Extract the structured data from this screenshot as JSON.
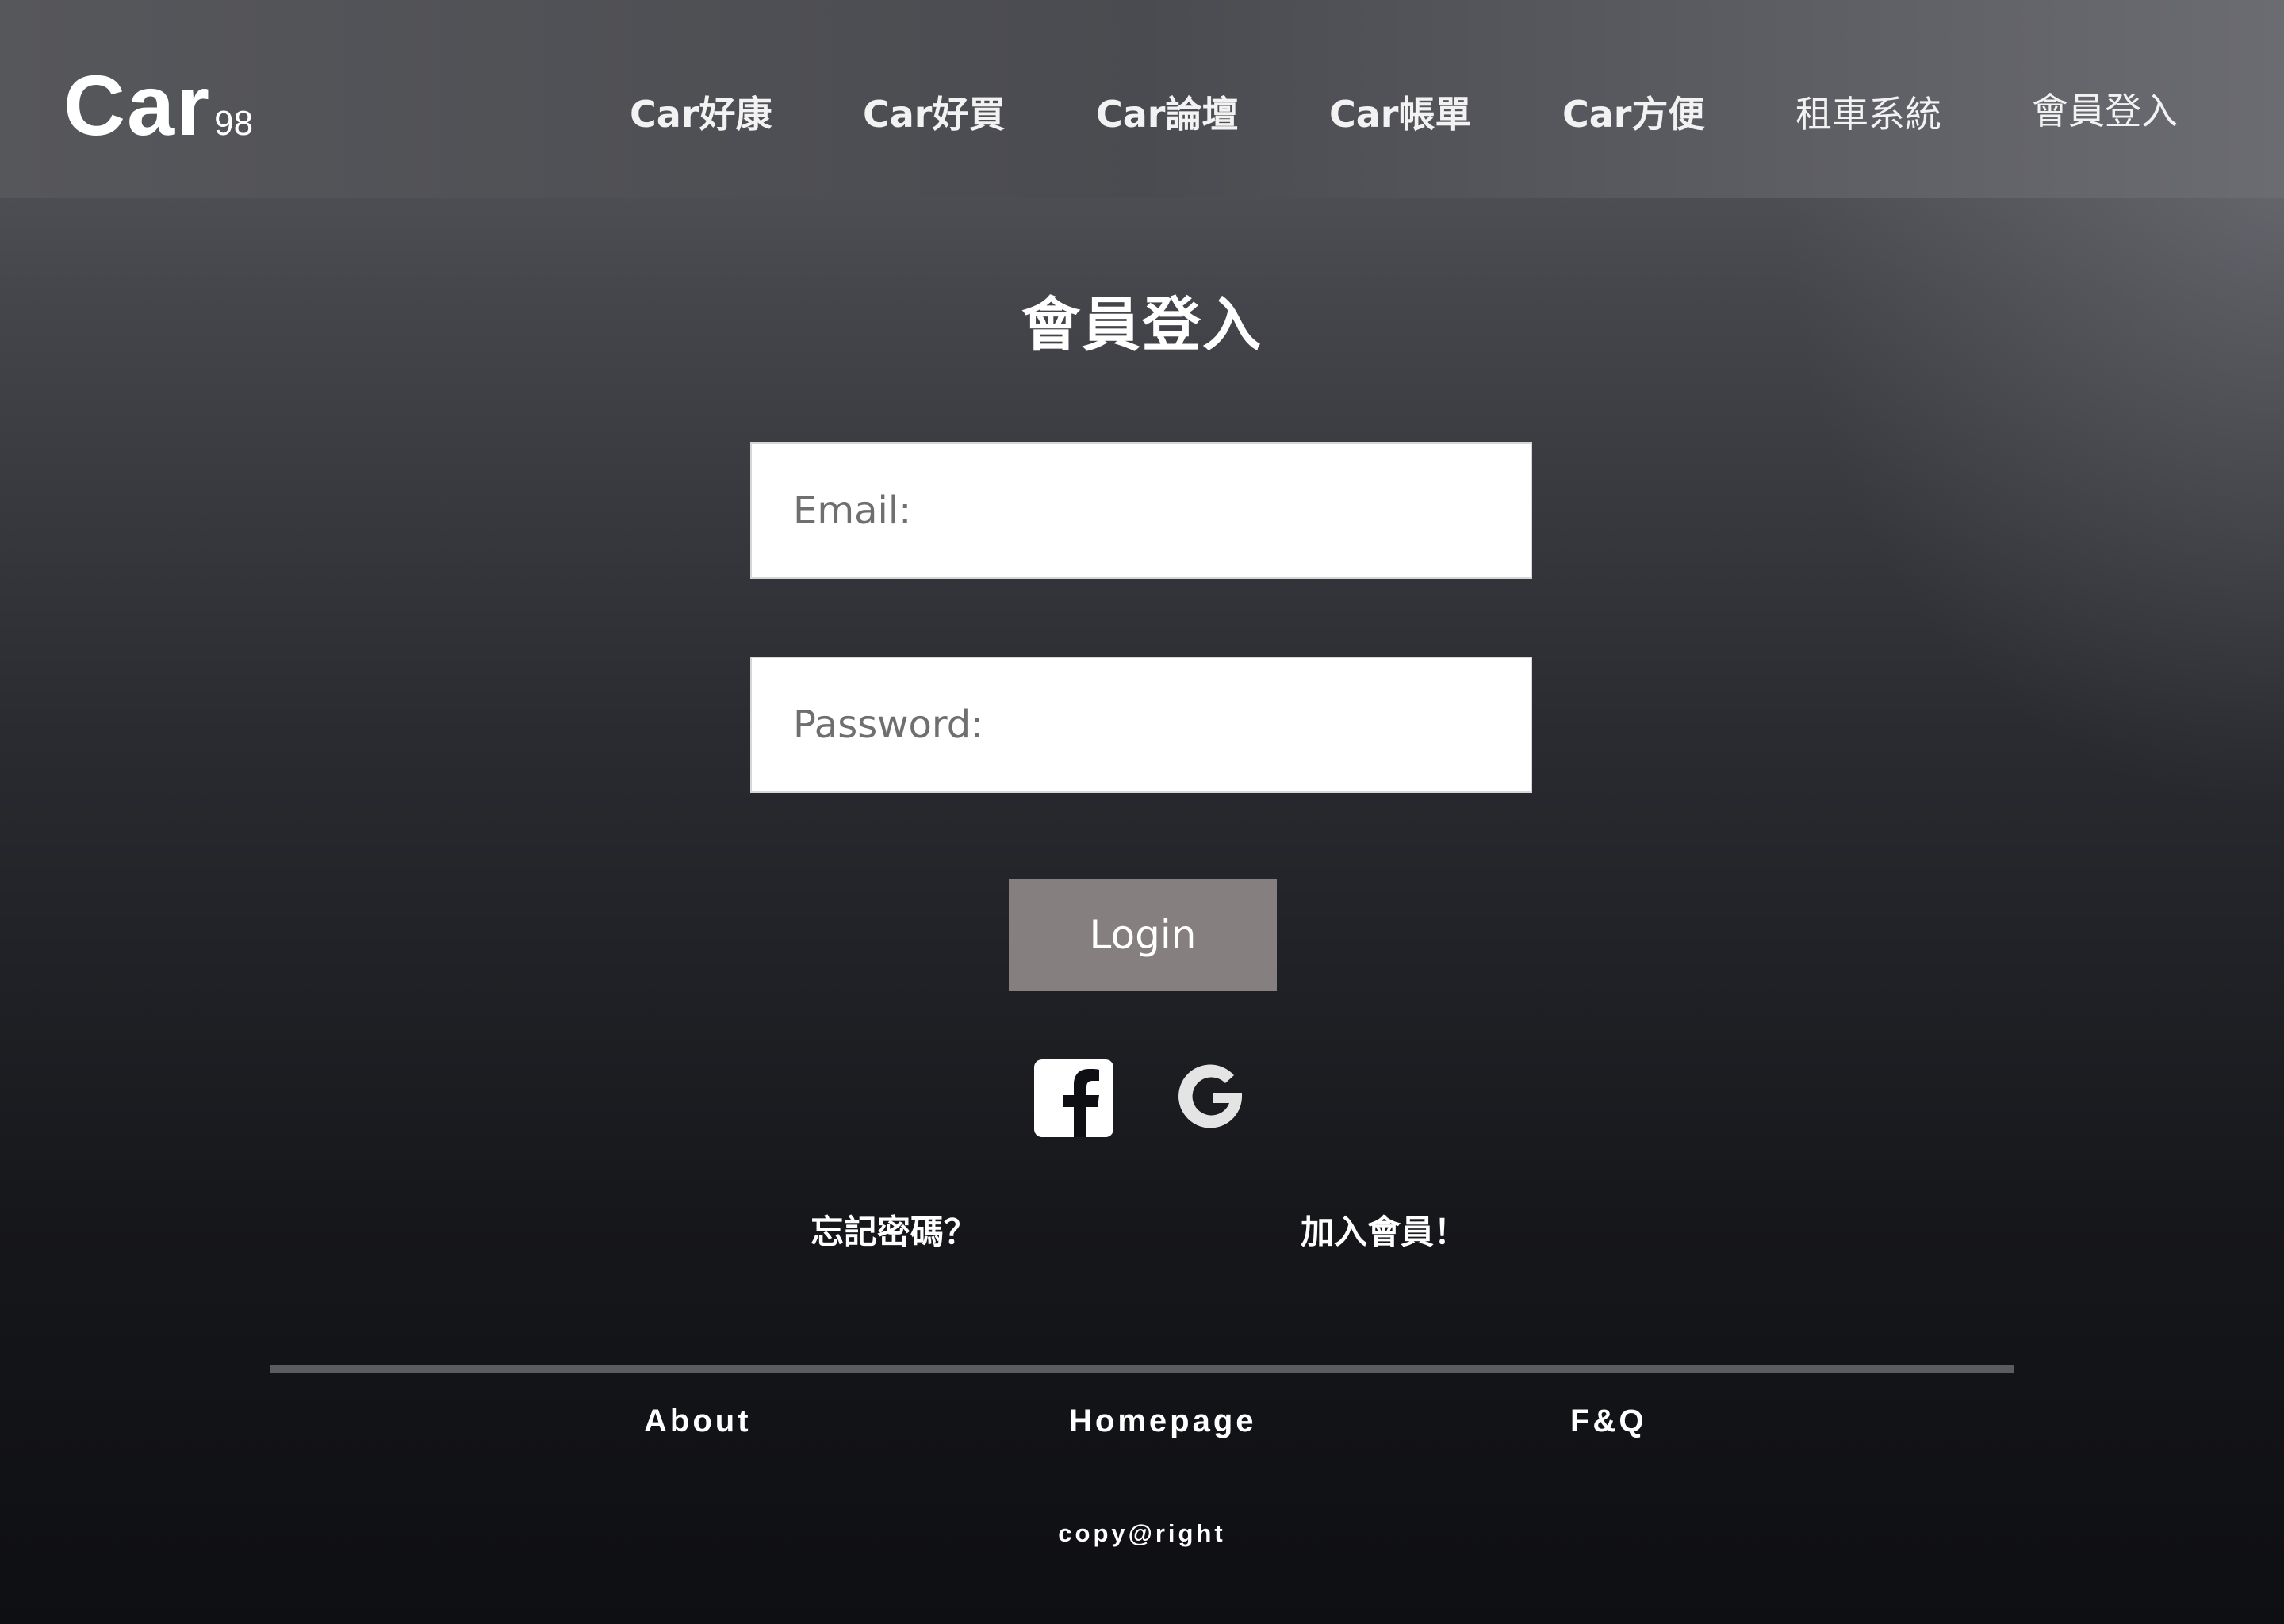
{
  "logo": {
    "main": "Car",
    "sub": "98"
  },
  "nav": [
    {
      "label": "Car好康"
    },
    {
      "label": "Car好買"
    },
    {
      "label": "Car論壇"
    },
    {
      "label": "Car帳單"
    },
    {
      "label": "Car方便"
    },
    {
      "label": "租車系統"
    },
    {
      "label": "會員登入"
    }
  ],
  "login": {
    "title": "會員登入",
    "email_placeholder": "Email:",
    "password_placeholder": "Password:",
    "submit_label": "Login",
    "forgot_label": "忘記密碼？",
    "join_label": "加入會員！"
  },
  "social": [
    {
      "icon": "facebook-icon"
    },
    {
      "icon": "google-icon"
    }
  ],
  "footer": {
    "links": [
      {
        "label": "About"
      },
      {
        "label": "Homepage"
      },
      {
        "label": "F&Q"
      }
    ],
    "copyright": "copy@right"
  },
  "colors": {
    "button_bg": "#867f7f",
    "background_top": "#5d5e63",
    "background_bottom": "#0e0f13",
    "divider": "#5b5b60"
  }
}
